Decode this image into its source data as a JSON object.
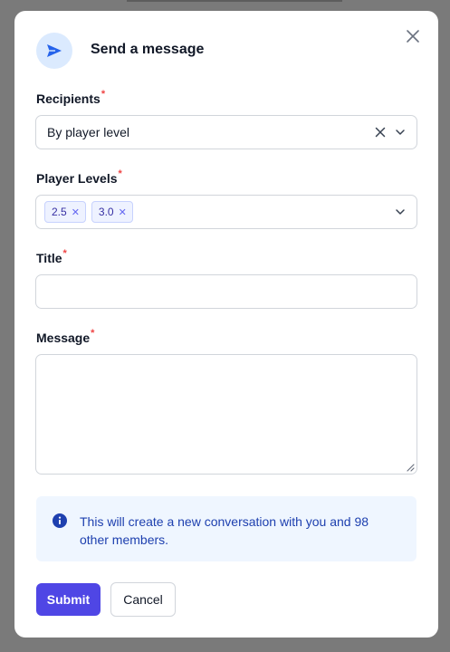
{
  "dialog": {
    "title": "Send a message",
    "close_icon": "close-icon",
    "header_icon": "send-icon"
  },
  "form": {
    "recipients": {
      "label": "Recipients",
      "required_mark": "*",
      "value": "By player level"
    },
    "player_levels": {
      "label": "Player Levels",
      "required_mark": "*",
      "chips": [
        "2.5",
        "3.0"
      ]
    },
    "title": {
      "label": "Title",
      "required_mark": "*",
      "value": ""
    },
    "message": {
      "label": "Message",
      "required_mark": "*",
      "value": ""
    }
  },
  "info": {
    "icon": "info-icon",
    "text": "This will create a new conversation with you and 98 other members."
  },
  "actions": {
    "submit_label": "Submit",
    "cancel_label": "Cancel"
  },
  "colors": {
    "accent": "#4f46e5",
    "send_icon": "#2563eb",
    "info_bg": "#eff6ff",
    "info_text": "#1e40af",
    "required": "#ef4444"
  }
}
